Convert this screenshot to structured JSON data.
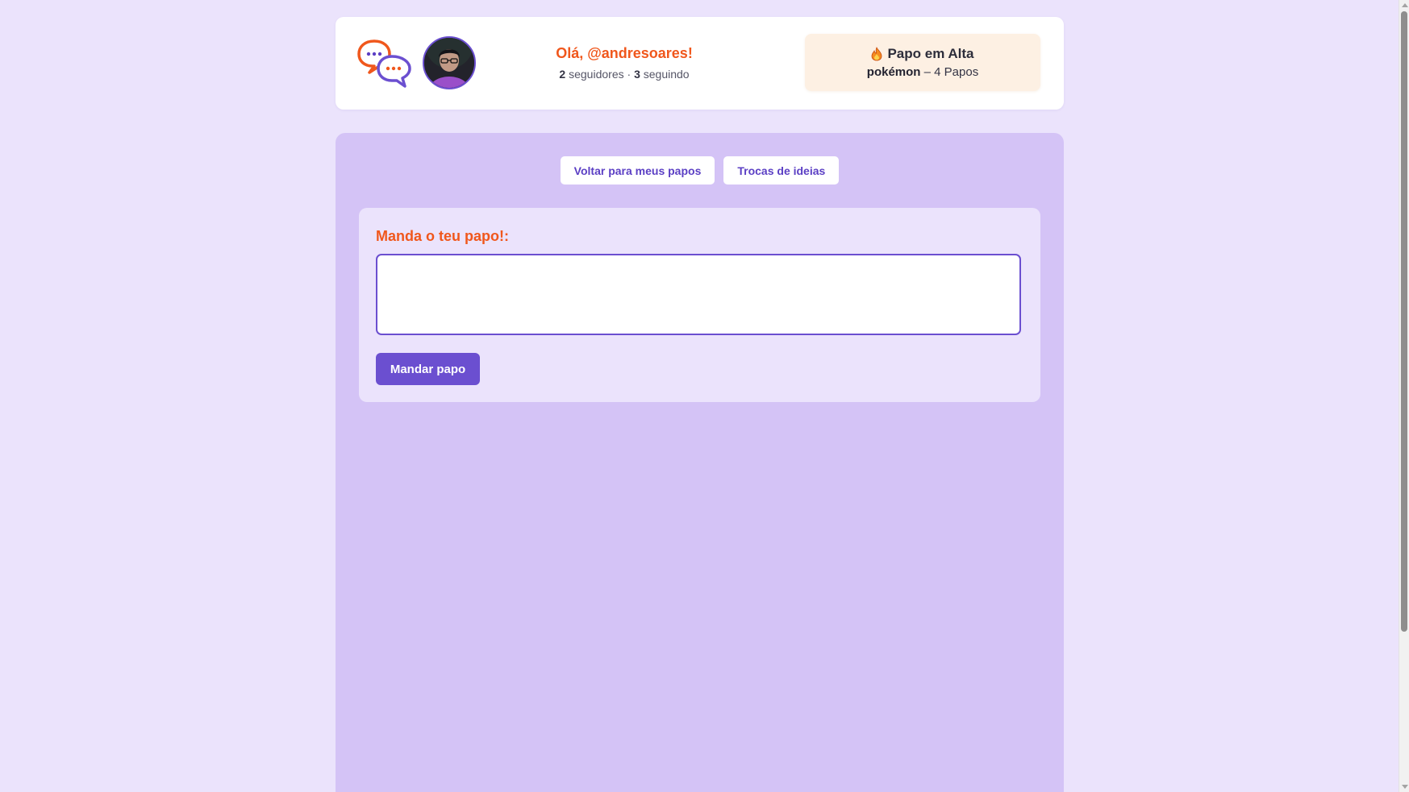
{
  "header": {
    "greeting": "Olá, @andresoares!",
    "followers_count": "2",
    "followers_label": "seguidores",
    "separator": "·",
    "following_count": "3",
    "following_label": "seguindo",
    "logo_icon": "chat-bubbles-icon",
    "avatar_icon": "user-avatar"
  },
  "trending": {
    "icon": "fire-icon",
    "title": "Papo em Alta",
    "topic": "pokémon",
    "dash": "–",
    "count_text": "4 Papos"
  },
  "nav": {
    "back_label": "Voltar para meus papos",
    "ideas_label": "Trocas de ideias"
  },
  "compose": {
    "label": "Manda o teu papo!:",
    "input_value": "",
    "send_label": "Mandar papo"
  },
  "colors": {
    "background": "#ebe3fc",
    "panel": "#d4c3f6",
    "accent_orange": "#f0571c",
    "accent_purple": "#6b4fd0",
    "trending_bg": "#fdf0e3"
  }
}
